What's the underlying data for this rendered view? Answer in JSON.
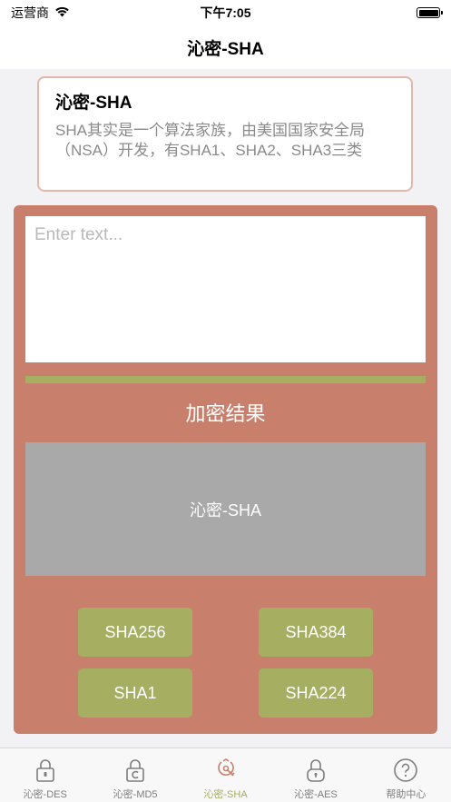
{
  "status_bar": {
    "carrier": "运营商",
    "time": "下午7:05"
  },
  "nav": {
    "title": "沁密-SHA"
  },
  "info_card": {
    "title": "沁密-SHA",
    "description": "SHA其实是一个算法家族，由美国国家安全局（NSA）开发，有SHA1、SHA2、SHA3三类"
  },
  "main": {
    "input_placeholder": "Enter text...",
    "input_value": "",
    "result_label": "加密结果",
    "result_text": "沁密-SHA",
    "buttons": {
      "sha256": "SHA256",
      "sha384": "SHA384",
      "sha1": "SHA1",
      "sha224": "SHA224"
    }
  },
  "tabs": [
    {
      "label": "沁密-DES",
      "icon": "lock-icon",
      "active": false
    },
    {
      "label": "沁密-MD5",
      "icon": "lock-c-icon",
      "active": false
    },
    {
      "label": "沁密-SHA",
      "icon": "key-lock-icon",
      "active": true
    },
    {
      "label": "沁密-AES",
      "icon": "padlock-icon",
      "active": false
    },
    {
      "label": "帮助中心",
      "icon": "help-icon",
      "active": false
    }
  ],
  "colors": {
    "panel": "#c8806d",
    "accent": "#a6ae62",
    "result_box": "#a9a9a9",
    "card_border": "#e3b8ab"
  }
}
